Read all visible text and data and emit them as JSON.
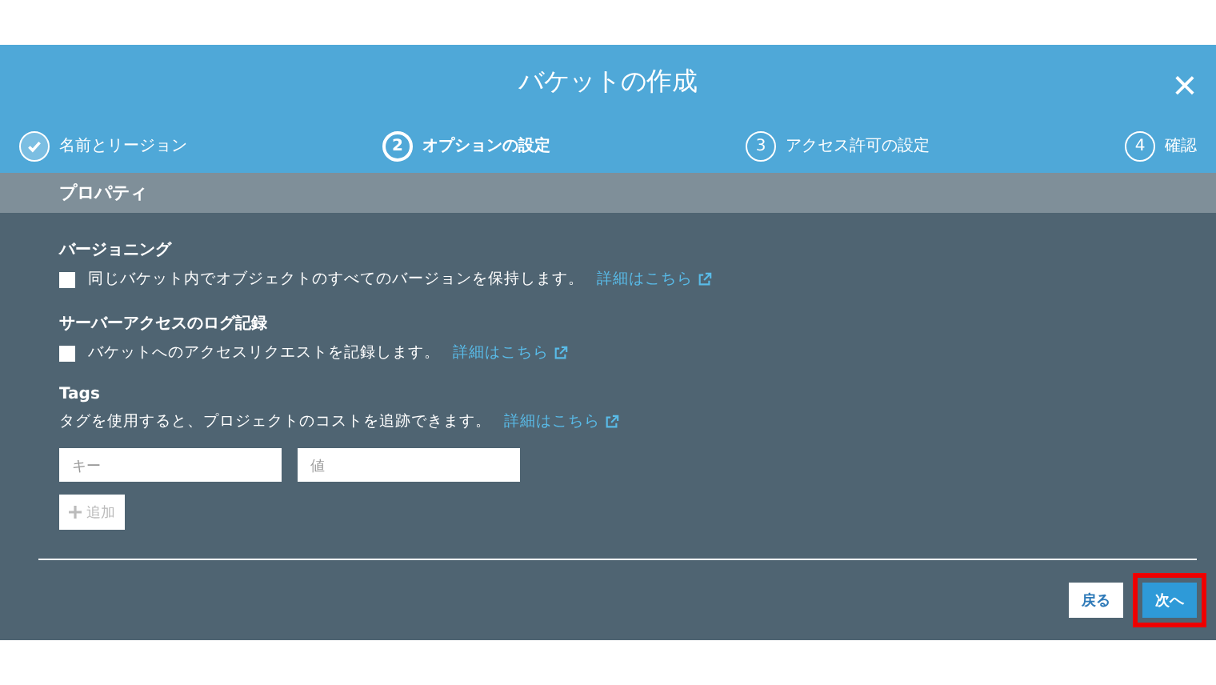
{
  "dialog": {
    "title": "バケットの作成",
    "close": "×"
  },
  "steps": [
    {
      "label": "名前とリージョン",
      "done": true,
      "selected": false
    },
    {
      "number": "2",
      "label": "オプションの設定",
      "done": false,
      "selected": true
    },
    {
      "number": "3",
      "label": "アクセス許可の設定",
      "done": false,
      "selected": false
    },
    {
      "number": "4",
      "label": "確認",
      "done": false,
      "selected": false
    }
  ],
  "section": {
    "title": "プロパティ"
  },
  "options": [
    {
      "heading": "バージョニング",
      "label": "同じバケット内でオブジェクトのすべてのバージョンを保持します。",
      "link": "詳細はこちら",
      "checked": false
    },
    {
      "heading": "サーバーアクセスのログ記録",
      "label": "バケットへのアクセスリクエストを記録します。",
      "link": "詳細はこちら",
      "checked": false
    }
  ],
  "tags": {
    "heading": "Tags",
    "description": "タグを使用すると、プロジェクトのコストを追跡できます。",
    "link": "詳細はこちら",
    "key_placeholder": "キー",
    "value_placeholder": "値",
    "add_button": {
      "label": "追加",
      "disabled": true
    }
  },
  "footer": {
    "buttons": [
      {
        "label": "戻る",
        "kind": "secondary",
        "highlighted": false
      },
      {
        "label": "次へ",
        "kind": "primary",
        "highlighted": true
      }
    ]
  }
}
